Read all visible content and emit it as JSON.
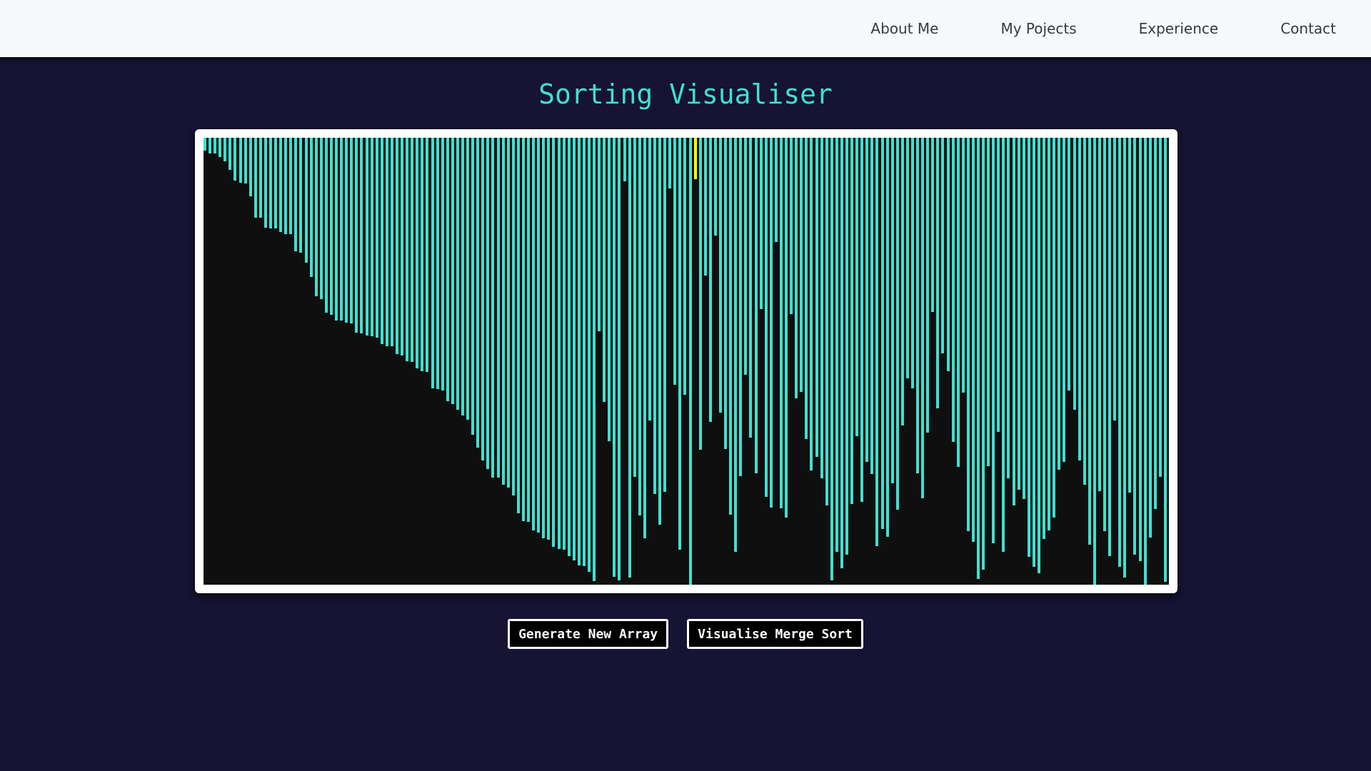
{
  "nav": {
    "links": [
      "About Me",
      "My Pojects",
      "Experience",
      "Contact"
    ]
  },
  "title": "Sorting Visualiser",
  "buttons": {
    "generate": "Generate New Array",
    "visualise": "Visualise Merge Sort"
  },
  "colors": {
    "background": "#161333",
    "bar": "#40e0d0",
    "highlight": "#ffff00",
    "bar_area": "#0f0f0f",
    "title": "#40e0d0"
  },
  "array_state": {
    "max_value": 626,
    "highlight_index": 97,
    "values": [
      18,
      22,
      22,
      27,
      33,
      45,
      60,
      63,
      64,
      82,
      112,
      112,
      126,
      127,
      127,
      132,
      135,
      135,
      159,
      161,
      175,
      195,
      222,
      226,
      245,
      248,
      256,
      256,
      259,
      260,
      273,
      274,
      277,
      278,
      280,
      289,
      292,
      292,
      303,
      305,
      313,
      314,
      323,
      327,
      328,
      351,
      352,
      354,
      369,
      373,
      381,
      389,
      395,
      416,
      434,
      452,
      464,
      476,
      476,
      486,
      490,
      501,
      526,
      537,
      538,
      550,
      553,
      561,
      563,
      573,
      576,
      577,
      586,
      592,
      599,
      600,
      608,
      621,
      271,
      370,
      425,
      615,
      620,
      61,
      616,
      475,
      529,
      561,
      396,
      499,
      542,
      496,
      71,
      346,
      577,
      360,
      628,
      58,
      437,
      193,
      398,
      137,
      385,
      436,
      528,
      580,
      474,
      332,
      420,
      470,
      240,
      503,
      518,
      146,
      519,
      532,
      247,
      365,
      356,
      422,
      466,
      447,
      477,
      515,
      620,
      580,
      603,
      584,
      513,
      418,
      510,
      454,
      471,
      572,
      548,
      559,
      484,
      521,
      403,
      337,
      351,
      470,
      505,
      413,
      244,
      379,
      302,
      327,
      426,
      461,
      357,
      551,
      566,
      618,
      605,
      460,
      568,
      412,
      580,
      477,
      515,
      493,
      506,
      587,
      601,
      610,
      562,
      550,
      532,
      465,
      454,
      354,
      381,
      452,
      486,
      570,
      630,
      495,
      551,
      586,
      396,
      601,
      616,
      497,
      584,
      593,
      638,
      560,
      520,
      475,
      622
    ]
  }
}
